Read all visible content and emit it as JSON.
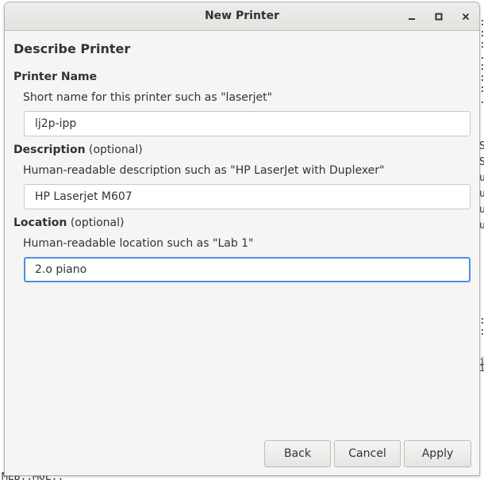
{
  "background_terminal": {
    "right_edge_lines": [
      ":",
      ":",
      ":",
      ".",
      ":",
      ":",
      ":",
      ".",
      "S",
      "S",
      "u",
      "u",
      "u",
      "u",
      ":",
      ":",
      "i",
      "i"
    ],
    "bottom_text": "MEB::MOL::"
  },
  "window": {
    "title": "New Printer",
    "minimize_icon": "minimize-icon",
    "maximize_icon": "maximize-icon",
    "close_icon": "close-icon"
  },
  "page": {
    "heading": "Describe Printer"
  },
  "printer_name": {
    "label": "Printer Name",
    "hint": "Short name for this printer such as \"laserjet\"",
    "value": "lj2p-ipp"
  },
  "description": {
    "label": "Description",
    "optional": " (optional)",
    "hint": "Human-readable description such as \"HP LaserJet with Duplexer\"",
    "value": "HP Laserjet M607"
  },
  "location": {
    "label": "Location",
    "optional": " (optional)",
    "hint": "Human-readable location such as \"Lab 1\"",
    "value": "2.o piano"
  },
  "buttons": {
    "back": "Back",
    "cancel": "Cancel",
    "apply": "Apply"
  },
  "colors": {
    "focus_border": "#4a90d9",
    "dialog_bg": "#f6f5f4",
    "text": "#2e3436"
  }
}
